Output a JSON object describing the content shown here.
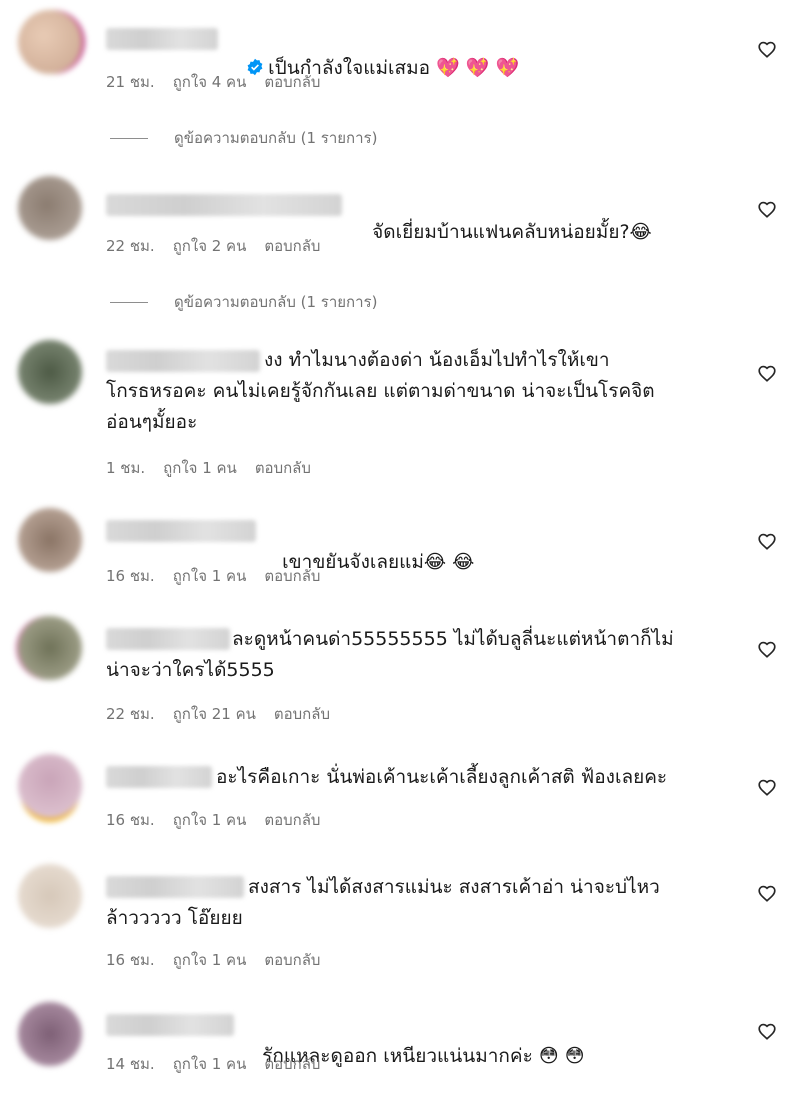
{
  "comments": [
    {
      "text": "เป็นกำลังใจแม่เสมอ",
      "emoji": "💖 💖 💖",
      "time": "21 ชม.",
      "likes": "ถูกใจ 4 คน",
      "reply": "ตอบกลับ",
      "verified": true
    },
    {
      "text": "จัดเยี่ยมบ้านแฟนคลับหน่อยมั้ย?",
      "emoji": "😂",
      "time": "22 ชม.",
      "likes": "ถูกใจ 2 คน",
      "reply": "ตอบกลับ"
    },
    {
      "text": "งง ทำไมนางต้องด่า น้องเอ็มไปทำไรให้เขา\nโกรธหรอคะ คนไม่เคยรู้จักกันเลย แต่ตามด่าขนาด น่าจะเป็นโรคจิต\nอ่อนๆมั้ยอะ",
      "emoji": "",
      "time": "1 ชม.",
      "likes": "ถูกใจ 1 คน",
      "reply": "ตอบกลับ"
    },
    {
      "text": "เขาขยันจังเลยแม่",
      "emoji": "😂 😂",
      "time": "16 ชม.",
      "likes": "ถูกใจ 1 คน",
      "reply": "ตอบกลับ"
    },
    {
      "text": "ละดูหน้าคนด่า55555555 ไม่ได้บลูลี่นะแต่หน้าตาก็ไม่\nน่าจะว่าใครได้5555",
      "emoji": "",
      "time": "22 ชม.",
      "likes": "ถูกใจ 21 คน",
      "reply": "ตอบกลับ"
    },
    {
      "text": "อะไรคือเกาะ นั่นพ่อเค้านะเค้าเลี้ยงลูกเค้าสติ ฟ้องเลยคะ",
      "emoji": "",
      "time": "16 ชม.",
      "likes": "ถูกใจ 1 คน",
      "reply": "ตอบกลับ"
    },
    {
      "text": "สงสาร ไม่ได้สงสารแม่นะ สงสารเค้าอ่า น่าจะบ่ไหว\nล้าววววว โอ๊ยยย",
      "emoji": "",
      "time": "16 ชม.",
      "likes": "ถูกใจ 1 คน",
      "reply": "ตอบกลับ"
    },
    {
      "text": "รักแหละดูออก เหนียวแน่นมากค่ะ",
      "emoji": "😳 😳",
      "time": "14 ชม.",
      "likes": "ถูกใจ 1 คน",
      "reply": "ตอบกลับ"
    }
  ],
  "view_replies": [
    "ดูข้อความตอบกลับ (1 รายการ)",
    "ดูข้อความตอบกลับ (1 รายการ)"
  ],
  "colors": {
    "meta": "#737373",
    "heart_outline": "#262626",
    "verified": "#0095f6"
  },
  "icons": {
    "like": "heart-outline-icon",
    "verified": "verified-badge-icon"
  }
}
